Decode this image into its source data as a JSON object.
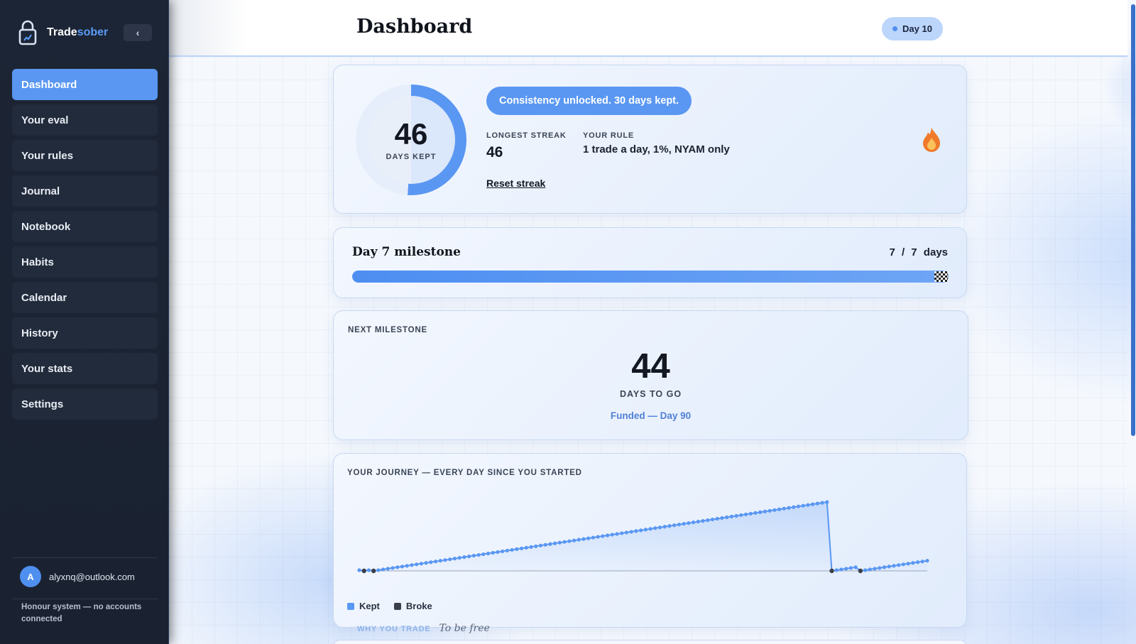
{
  "app": {
    "name_main": "Trade",
    "name_accent": "sober",
    "collapse_icon": "‹"
  },
  "sidebar": {
    "items": [
      {
        "label": "Dashboard",
        "active": true
      },
      {
        "label": "Your eval"
      },
      {
        "label": "Your rules"
      },
      {
        "label": "Journal"
      },
      {
        "label": "Notebook"
      },
      {
        "label": "Habits"
      },
      {
        "label": "Calendar"
      },
      {
        "label": "History"
      },
      {
        "label": "Your stats"
      },
      {
        "label": "Settings"
      }
    ],
    "user": {
      "avatar_initial": "A",
      "email": "alyxnq@outlook.com"
    },
    "footer_note": "Honour system — no accounts connected"
  },
  "header": {
    "title": "Dashboard",
    "day_badge": "Day 10"
  },
  "streak": {
    "days_kept": "46",
    "days_kept_label": "DAYS KEPT",
    "ring_progress": 0.51,
    "banner": "Consistency unlocked. 30 days kept.",
    "longest_streak_label": "LONGEST STREAK",
    "longest_streak_value": "46",
    "rule_label": "YOUR RULE",
    "rule_value": "1 trade a day, 1%, NYAM only",
    "reset_link": "Reset streak",
    "icon": "flame-icon"
  },
  "milestone": {
    "title": "Day 7 milestone",
    "count": "7 / 7 days",
    "progress": 1.0
  },
  "next_milestone": {
    "label": "NEXT MILESTONE",
    "days": "44",
    "days_label": "DAYS TO GO",
    "target": "Funded — Day 90"
  },
  "journey": {
    "label": "YOUR JOURNEY — EVERY DAY SINCE YOU STARTED",
    "legend": [
      {
        "label": "Kept",
        "color": "#5a97f2"
      },
      {
        "label": "Broke",
        "color": "#3a3f4a"
      }
    ]
  },
  "why": {
    "label": "WHY YOU TRADE",
    "value": "To be free"
  },
  "colors": {
    "accent": "#5a97f2",
    "sidebar": "#1c2535",
    "broke": "#3a3f4a"
  },
  "chart_data": {
    "type": "line",
    "title": "YOUR JOURNEY — EVERY DAY SINCE YOU STARTED",
    "xlabel": "",
    "ylabel": "",
    "x": [
      1,
      2,
      3,
      4,
      5,
      6,
      7,
      8,
      9,
      10,
      11,
      12,
      13,
      14,
      15,
      16,
      17,
      18,
      19,
      20,
      21,
      22,
      23,
      24,
      25,
      26,
      27,
      28,
      29,
      30,
      31,
      32,
      33,
      34,
      35,
      36,
      37,
      38,
      39,
      40,
      41,
      42,
      43,
      44,
      45,
      46,
      47,
      48,
      49,
      50,
      51,
      52,
      53,
      54,
      55,
      56,
      57,
      58,
      59,
      60,
      61,
      62,
      63,
      64,
      65,
      66,
      67,
      68,
      69,
      70,
      71,
      72,
      73,
      74,
      75,
      76,
      77,
      78,
      79,
      80,
      81,
      82,
      83,
      84,
      85,
      86,
      87,
      88,
      89,
      90,
      91,
      92,
      93,
      94,
      95,
      96,
      97,
      98,
      99,
      100,
      101,
      102,
      103,
      104,
      105,
      106,
      107,
      108,
      109,
      110,
      111,
      112,
      113,
      114,
      115,
      116,
      117,
      118,
      119,
      120
    ],
    "series": [
      {
        "name": "Kept",
        "values": [
          1,
          0,
          1,
          0,
          1,
          2,
          3,
          4,
          5,
          6,
          7,
          8,
          9,
          10,
          11,
          12,
          13,
          14,
          15,
          16,
          17,
          18,
          19,
          20,
          21,
          22,
          23,
          24,
          25,
          26,
          27,
          28,
          29,
          30,
          31,
          32,
          33,
          34,
          35,
          36,
          37,
          38,
          39,
          40,
          41,
          42,
          43,
          44,
          45,
          46,
          47,
          48,
          49,
          50,
          51,
          52,
          53,
          54,
          55,
          56,
          57,
          58,
          59,
          60,
          61,
          62,
          63,
          64,
          65,
          66,
          67,
          68,
          69,
          70,
          71,
          72,
          73,
          74,
          75,
          76,
          77,
          78,
          79,
          80,
          81,
          82,
          83,
          84,
          85,
          86,
          87,
          88,
          89,
          90,
          91,
          92,
          93,
          94,
          95,
          0,
          1,
          2,
          3,
          4,
          5,
          0,
          1,
          2,
          3,
          4,
          5,
          6,
          7,
          8,
          9,
          10,
          11,
          12,
          13,
          14
        ]
      },
      {
        "name": "Broke",
        "days": [
          2,
          4,
          100,
          106
        ]
      }
    ],
    "ylim": [
      0,
      100
    ],
    "grid": false,
    "legend_position": "bottom-left"
  }
}
